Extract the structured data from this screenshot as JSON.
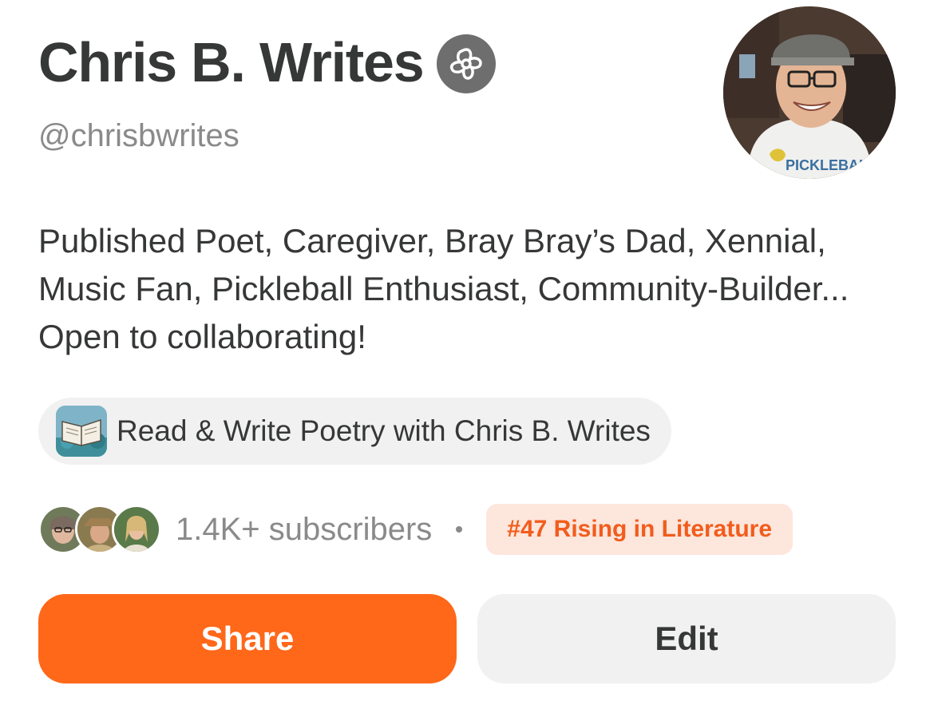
{
  "profile": {
    "display_name": "Chris B. Writes",
    "handle": "@chrisbwrites",
    "bio": "Published Poet, Caregiver, Bray Bray’s Dad, Xennial, Music Fan, Pickleball Enthusiast, Community-Builder... Open to collaborating!",
    "verified_icon": "flower-badge-icon",
    "avatar_icon": "profile-photo"
  },
  "publication": {
    "name": "Read & Write Poetry with Chris B. Writes",
    "thumb_icon": "open-book-icon"
  },
  "stats": {
    "subscribers": "1.4K+ subscribers",
    "rank": "#47 Rising in Literature"
  },
  "actions": {
    "share_label": "Share",
    "edit_label": "Edit"
  },
  "colors": {
    "accent": "#ff6719",
    "rank_bg": "#fde6dc",
    "rank_text": "#f25c1c",
    "muted": "#8a8a8a",
    "text": "#363737"
  }
}
